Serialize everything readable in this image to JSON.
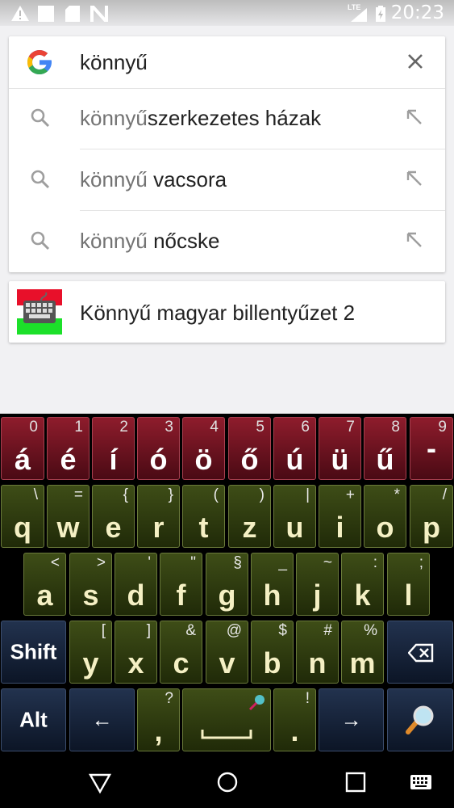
{
  "status_bar": {
    "time": "20:23",
    "network": "LTE",
    "icons": [
      "warning-icon",
      "square-notification-icon",
      "sd-card-icon",
      "n-notification-icon",
      "signal-icon",
      "battery-icon"
    ]
  },
  "search": {
    "query": "könnyű",
    "suggestions": [
      {
        "prefix": "könnyű",
        "suffix": "szerkezetes házak"
      },
      {
        "prefix": "könnyű",
        "suffix": " vacsora"
      },
      {
        "prefix": "könnyű",
        "suffix": " nőcske"
      }
    ]
  },
  "app_result": {
    "name": "Könnyű magyar billentyűzet 2"
  },
  "keyboard": {
    "row1": [
      {
        "main": "á",
        "sub": "0"
      },
      {
        "main": "é",
        "sub": "1"
      },
      {
        "main": "í",
        "sub": "2"
      },
      {
        "main": "ó",
        "sub": "3"
      },
      {
        "main": "ö",
        "sub": "4"
      },
      {
        "main": "ő",
        "sub": "5"
      },
      {
        "main": "ú",
        "sub": "6"
      },
      {
        "main": "ü",
        "sub": "7"
      },
      {
        "main": "ű",
        "sub": "8"
      },
      {
        "main": "-",
        "sub": "9"
      }
    ],
    "row2": [
      {
        "main": "q",
        "sub": "\\"
      },
      {
        "main": "w",
        "sub": "="
      },
      {
        "main": "e",
        "sub": "{"
      },
      {
        "main": "r",
        "sub": "}"
      },
      {
        "main": "t",
        "sub": "("
      },
      {
        "main": "z",
        "sub": ")"
      },
      {
        "main": "u",
        "sub": "|"
      },
      {
        "main": "i",
        "sub": "+"
      },
      {
        "main": "o",
        "sub": "*"
      },
      {
        "main": "p",
        "sub": "/"
      }
    ],
    "row3": [
      {
        "main": "a",
        "sub": "<"
      },
      {
        "main": "s",
        "sub": ">"
      },
      {
        "main": "d",
        "sub": "'"
      },
      {
        "main": "f",
        "sub": "\""
      },
      {
        "main": "g",
        "sub": "§"
      },
      {
        "main": "h",
        "sub": "_"
      },
      {
        "main": "j",
        "sub": "~"
      },
      {
        "main": "k",
        "sub": ":"
      },
      {
        "main": "l",
        "sub": ";"
      }
    ],
    "row4": [
      {
        "main": "y",
        "sub": "["
      },
      {
        "main": "x",
        "sub": "]"
      },
      {
        "main": "c",
        "sub": "&"
      },
      {
        "main": "v",
        "sub": "@"
      },
      {
        "main": "b",
        "sub": "$"
      },
      {
        "main": "n",
        "sub": "#"
      },
      {
        "main": "m",
        "sub": "%"
      }
    ],
    "shift_label": "Shift",
    "alt_label": "Alt",
    "left_arrow": "←",
    "right_arrow": "→",
    "comma": {
      "main": ",",
      "sub": "?"
    },
    "period": {
      "main": ".",
      "sub": "!"
    }
  },
  "colors": {
    "number_row": "#6a1220",
    "letter_keys": "#2e3a10",
    "function_keys": "#17233a",
    "letter_text": "#f5f0c4"
  }
}
